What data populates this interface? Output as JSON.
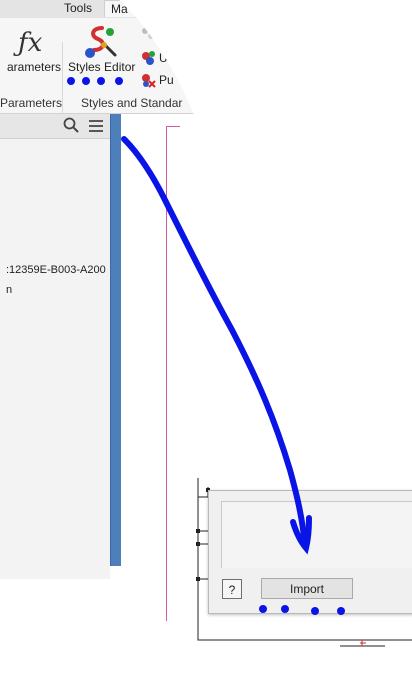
{
  "ribbon": {
    "tabs": [
      "Tools",
      "Ma"
    ],
    "params_button_label": "arameters",
    "styles_editor_label": "Styles Editor",
    "small_btn_2_label": "U",
    "small_btn_3_label": "Pu",
    "group_params_label": "Parameters",
    "group_styles_label": "Styles and Standar"
  },
  "browser": {
    "tree_item_1": ":12359E-B003-A200",
    "tree_item_2": "n"
  },
  "dialog": {
    "help_label": "?",
    "import_label": "Import"
  },
  "colors": {
    "annotation_blue": "#0a14e6",
    "browser_splitter": "#4d7fba",
    "drawing_border_magenta": "#d35aa8"
  }
}
